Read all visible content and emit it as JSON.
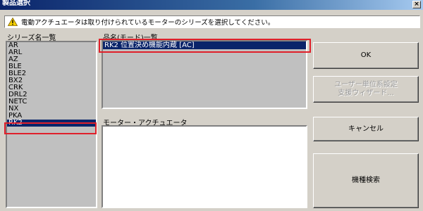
{
  "window": {
    "title": "製品選択"
  },
  "info": {
    "message": "電動アクチュエータは取り付けられているモーターのシリーズを選択してください。"
  },
  "series": {
    "label": "シリーズ名一覧",
    "items": [
      "AR",
      "ARL",
      "AZ",
      "BLE",
      "BLE2",
      "BX2",
      "CRK",
      "DRL2",
      "NETC",
      "NX",
      "PKA",
      "RK2"
    ],
    "selected": "RK2"
  },
  "products": {
    "label": "品名(モード)一覧",
    "items": [
      "RK2 位置決め機能内蔵 [AC]"
    ]
  },
  "motor": {
    "label": "モーター・アクチュエータ"
  },
  "buttons": {
    "ok": "OK",
    "wizard": "ユーザー単位系設定\n支援ウィザード...",
    "cancel": "キャンセル",
    "search": "機種検索"
  },
  "colors": {
    "highlight": "#0a246a",
    "annotation": "#e0202a"
  }
}
